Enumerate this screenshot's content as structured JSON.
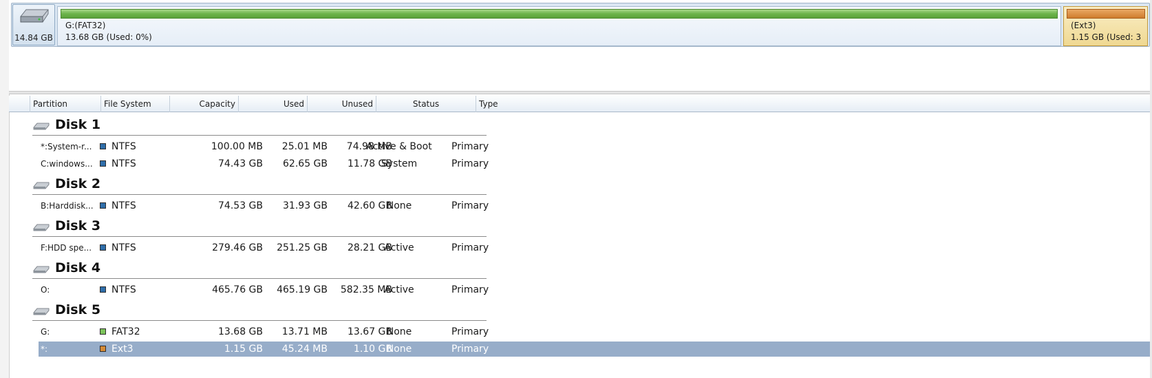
{
  "diskmap": {
    "disk_size": "14.84 GB",
    "partitions": [
      {
        "name": "G:(FAT32)",
        "info": "13.68 GB (Used: 0%)",
        "color": "#6cb34a"
      },
      {
        "name": "(Ext3)",
        "info": "1.15 GB (Used: 3",
        "color": "#cf7c2d"
      }
    ]
  },
  "table": {
    "columns": [
      "Partition",
      "File System",
      "Capacity",
      "Used",
      "Unused",
      "Status",
      "Type"
    ],
    "fs_colors": {
      "NTFS": "#2f6eaa",
      "FAT32": "#7cc45a",
      "Ext3": "#d58a35"
    },
    "disks": [
      {
        "title": "Disk 1",
        "rows": [
          {
            "partition": "*:System-r...",
            "fs": "NTFS",
            "capacity": "100.00 MB",
            "used": "25.01 MB",
            "unused": "74.98 MB",
            "status": "Active & Boot",
            "type": "Primary"
          },
          {
            "partition": "C:windows...",
            "fs": "NTFS",
            "capacity": "74.43 GB",
            "used": "62.65 GB",
            "unused": "11.78 GB",
            "status": "System",
            "type": "Primary"
          }
        ]
      },
      {
        "title": "Disk 2",
        "rows": [
          {
            "partition": "B:Harddisk...",
            "fs": "NTFS",
            "capacity": "74.53 GB",
            "used": "31.93 GB",
            "unused": "42.60 GB",
            "status": "None",
            "type": "Primary"
          }
        ]
      },
      {
        "title": "Disk 3",
        "rows": [
          {
            "partition": "F:HDD spe...",
            "fs": "NTFS",
            "capacity": "279.46 GB",
            "used": "251.25 GB",
            "unused": "28.21 GB",
            "status": "Active",
            "type": "Primary"
          }
        ]
      },
      {
        "title": "Disk 4",
        "rows": [
          {
            "partition": "O:",
            "fs": "NTFS",
            "capacity": "465.76 GB",
            "used": "465.19 GB",
            "unused": "582.35 MB",
            "status": "Active",
            "type": "Primary"
          }
        ]
      },
      {
        "title": "Disk 5",
        "rows": [
          {
            "partition": "G:",
            "fs": "FAT32",
            "capacity": "13.68 GB",
            "used": "13.71 MB",
            "unused": "13.67 GB",
            "status": "None",
            "type": "Primary"
          },
          {
            "partition": "*:",
            "fs": "Ext3",
            "capacity": "1.15 GB",
            "used": "45.24 MB",
            "unused": "1.10 GB",
            "status": "None",
            "type": "Primary",
            "selected": true
          }
        ]
      }
    ]
  }
}
